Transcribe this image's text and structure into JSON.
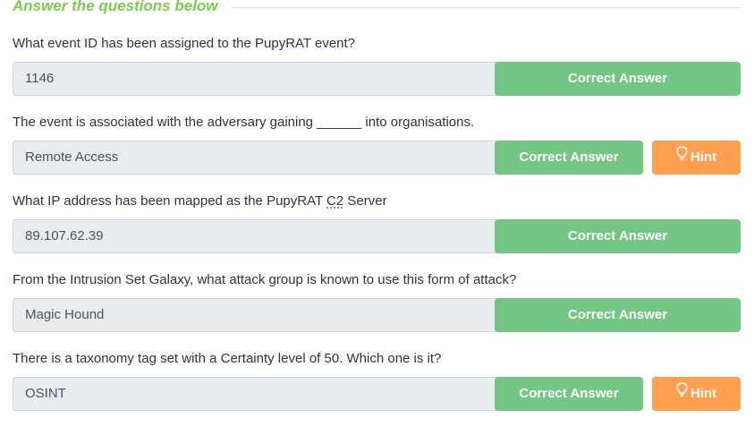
{
  "section_title": "Answer the questions below",
  "buttons": {
    "correct_label": "Correct Answer",
    "hint_label": "Hint"
  },
  "questions": [
    {
      "text": "What event ID has been assigned to the PupyRAT event?",
      "answer": "1146",
      "has_hint": false
    },
    {
      "text": "The event is associated with the adversary gaining ______ into organisations.",
      "answer": "Remote Access",
      "has_hint": true
    },
    {
      "text_before": "What IP address has been mapped as the PupyRAT ",
      "text_abbr": "C2",
      "text_after": " Server",
      "answer": "89.107.62.39",
      "has_hint": false
    },
    {
      "text": "From the Intrusion Set Galaxy, what attack group is known to use this form of attack?",
      "answer": "Magic Hound",
      "has_hint": false
    },
    {
      "text": "There is a taxonomy tag set with a Certainty level of 50. Which one is it?",
      "answer": "OSINT",
      "has_hint": true
    }
  ],
  "colors": {
    "title_green": "#7ccc4e",
    "correct_green": "#73c683",
    "hint_orange": "#ff9f4f",
    "field_bg": "#eaedf0"
  },
  "icons": {
    "hint": "lightbulb-icon"
  }
}
